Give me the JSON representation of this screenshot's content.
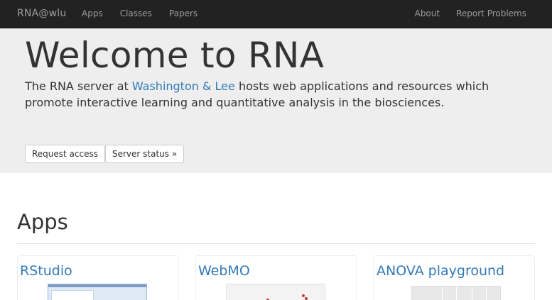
{
  "navbar": {
    "brand": "RNA@wlu",
    "left_links": [
      "Apps",
      "Classes",
      "Papers"
    ],
    "right_links": [
      "About",
      "Report Problems"
    ]
  },
  "jumbotron": {
    "title": "Welcome to RNA",
    "lead_prefix": "The RNA server at ",
    "lead_link": "Washington & Lee",
    "lead_suffix": " hosts web applications and resources which promote interactive learning and quantitative analysis in the biosciences.",
    "request_button": "Request access",
    "status_button": "Server status »"
  },
  "apps": {
    "heading": "Apps",
    "cards": [
      {
        "title": "RStudio",
        "icon": "rstudio-screenshot"
      },
      {
        "title": "WebMO",
        "icon": "webmo-screenshot"
      },
      {
        "title": "ANOVA playground",
        "icon": "anova-screenshot"
      }
    ]
  },
  "colors": {
    "navbar_bg": "#222222",
    "navbar_text": "#9d9d9d",
    "jumbotron_bg": "#eeeeee",
    "link": "#337ab7"
  }
}
